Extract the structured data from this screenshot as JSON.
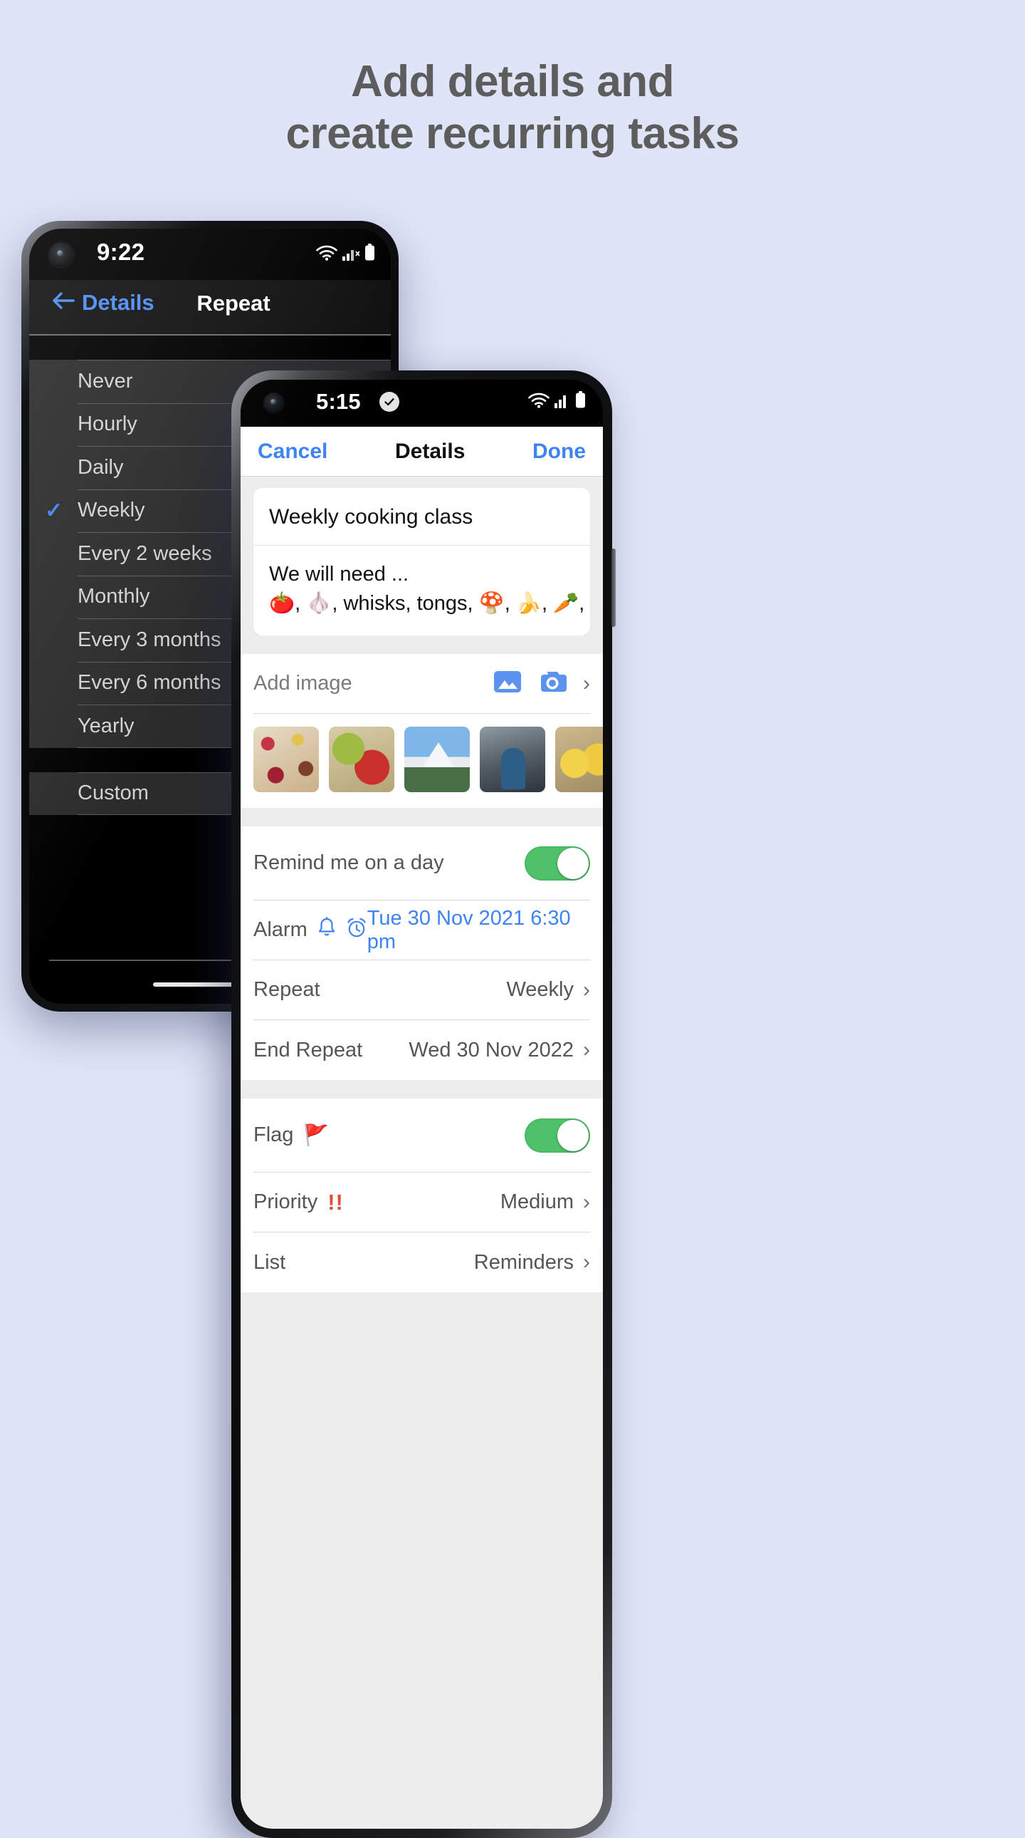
{
  "headline": {
    "line1": "Add details and",
    "line2": "create recurring tasks"
  },
  "colors": {
    "page_background": "#dfe4f7",
    "accent_blue": "#3d84f2",
    "toggle_green": "#4ec16a",
    "priority_red": "#e0503c",
    "headline_gray": "#5d5d5d"
  },
  "back_phone": {
    "status": {
      "time": "9:22",
      "icons": [
        "wifi-icon",
        "cellular-signal-icon",
        "battery-icon"
      ]
    },
    "nav": {
      "back_icon": "arrow-left-icon",
      "back_label": "Details",
      "title": "Repeat"
    },
    "repeat_options": [
      {
        "label": "Never",
        "selected": false
      },
      {
        "label": "Hourly",
        "selected": false
      },
      {
        "label": "Daily",
        "selected": false
      },
      {
        "label": "Weekly",
        "selected": true
      },
      {
        "label": "Every 2 weeks",
        "selected": false
      },
      {
        "label": "Monthly",
        "selected": false
      },
      {
        "label": "Every 3 months",
        "selected": false
      },
      {
        "label": "Every 6 months",
        "selected": false
      },
      {
        "label": "Yearly",
        "selected": false
      }
    ],
    "custom_option": {
      "label": "Custom"
    },
    "checkmark_glyph": "✓"
  },
  "front_phone": {
    "status": {
      "time": "5:15",
      "status_icon": "check-circle-icon",
      "icons": [
        "wifi-icon",
        "cellular-signal-icon",
        "battery-icon"
      ]
    },
    "nav": {
      "cancel_label": "Cancel",
      "title": "Details",
      "done_label": "Done"
    },
    "note": {
      "title": "Weekly cooking class",
      "body_line1": "We will need ...",
      "body_line2": "🍅, 🧄, whisks, tongs, 🍄, 🍌, 🥕, 🫑"
    },
    "add_image": {
      "label": "Add image",
      "gallery_icon": "image-icon",
      "camera_icon": "camera-icon",
      "chevron": "›"
    },
    "thumbnails": [
      {
        "name": "thumbnail-fruit-platter"
      },
      {
        "name": "thumbnail-grapes-apple"
      },
      {
        "name": "thumbnail-mountain"
      },
      {
        "name": "thumbnail-person-hiking"
      },
      {
        "name": "thumbnail-chicks"
      }
    ],
    "reminder_rows": [
      {
        "label": "Remind me on a day",
        "type": "toggle",
        "value_on": true
      },
      {
        "label": "Alarm",
        "type": "value-blue",
        "value": "Tue 30 Nov 2021 6:30 pm",
        "icons": [
          "bell-icon",
          "alarm-clock-icon"
        ]
      },
      {
        "label": "Repeat",
        "type": "value-chevron",
        "value": "Weekly",
        "chevron": "›"
      },
      {
        "label": "End Repeat",
        "type": "value-chevron",
        "value": "Wed 30 Nov 2022",
        "chevron": "›"
      }
    ],
    "meta_rows": [
      {
        "label": "Flag",
        "type": "toggle",
        "icon": "🚩",
        "value_on": true
      },
      {
        "label": "Priority",
        "type": "value-chevron",
        "icon": "!!",
        "value": "Medium",
        "chevron": "›"
      },
      {
        "label": "List",
        "type": "value-chevron",
        "value": "Reminders",
        "chevron": "›"
      }
    ]
  }
}
